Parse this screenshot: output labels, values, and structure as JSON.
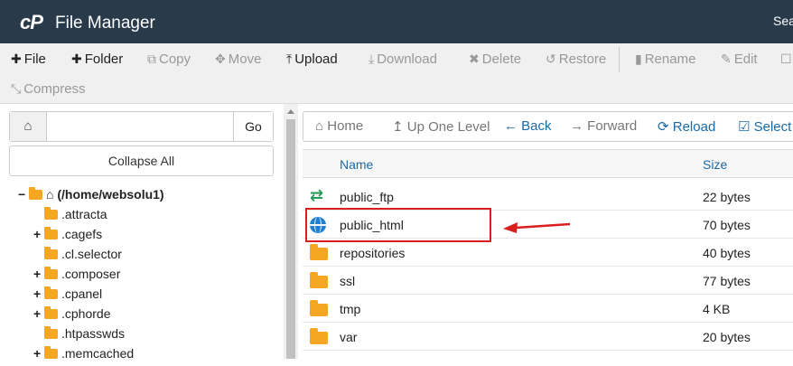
{
  "header": {
    "logo": "cP",
    "title": "File Manager",
    "search": "Sea"
  },
  "toolbar": {
    "file": "File",
    "folder": "Folder",
    "copy": "Copy",
    "move": "Move",
    "upload": "Upload",
    "download": "Download",
    "delete": "Delete",
    "restore": "Restore",
    "rename": "Rename",
    "edit": "Edit",
    "compress": "Compress"
  },
  "sidebar": {
    "path_value": "",
    "go_label": "Go",
    "collapse_label": "Collapse All",
    "tree": [
      {
        "toggle": "−",
        "label": "(/home/websolu1)",
        "root": true
      },
      {
        "toggle": "",
        "label": ".attracta"
      },
      {
        "toggle": "+",
        "label": ".cagefs"
      },
      {
        "toggle": "",
        "label": ".cl.selector"
      },
      {
        "toggle": "+",
        "label": ".composer"
      },
      {
        "toggle": "+",
        "label": ".cpanel"
      },
      {
        "toggle": "+",
        "label": ".cphorde"
      },
      {
        "toggle": "",
        "label": ".htpasswds"
      },
      {
        "toggle": "+",
        "label": ".memcached"
      }
    ]
  },
  "nav": {
    "home": "Home",
    "up": "Up One Level",
    "back": "Back",
    "forward": "Forward",
    "reload": "Reload",
    "select_all": "Select A"
  },
  "table": {
    "col_name": "Name",
    "col_size": "Size",
    "rows": [
      {
        "icon": "transfer-icon",
        "name": "public_ftp",
        "size": "22 bytes"
      },
      {
        "icon": "globe-icon",
        "name": "public_html",
        "size": "70 bytes"
      },
      {
        "icon": "folder-icon",
        "name": "repositories",
        "size": "40 bytes"
      },
      {
        "icon": "folder-icon",
        "name": "ssl",
        "size": "77 bytes"
      },
      {
        "icon": "folder-icon",
        "name": "tmp",
        "size": "4 KB"
      },
      {
        "icon": "folder-icon",
        "name": "var",
        "size": "20 bytes"
      }
    ]
  },
  "colors": {
    "header_bg": "#293a4a",
    "link_blue": "#1a6aa8",
    "folder": "#f5a623",
    "highlight": "#d9201f"
  }
}
